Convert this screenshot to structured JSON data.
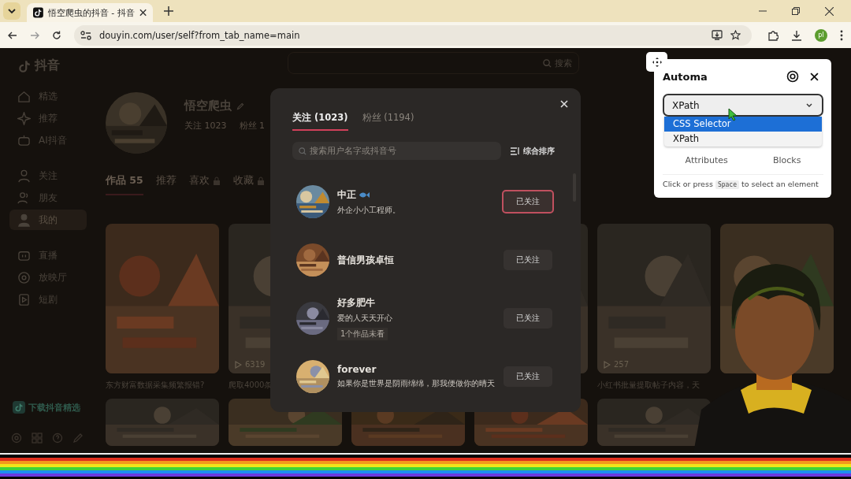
{
  "browser": {
    "tab": {
      "title": "悟空爬虫的抖音 - 抖音"
    },
    "url": "douyin.com/user/self?from_tab_name=main",
    "profile": "pl"
  },
  "page": {
    "logo": "抖音",
    "search_button": "搜索",
    "sidebar": [
      {
        "label": "精选",
        "selected": false
      },
      {
        "label": "推荐",
        "selected": false
      },
      {
        "label": "AI抖音",
        "selected": false
      },
      {
        "label": "关注",
        "selected": false
      },
      {
        "label": "朋友",
        "selected": false
      },
      {
        "label": "我的",
        "selected": true
      },
      {
        "label": "直播",
        "selected": false
      },
      {
        "label": "放映厅",
        "selected": false
      },
      {
        "label": "短剧",
        "selected": false
      }
    ],
    "download": "下载抖音精选",
    "profile": {
      "name": "悟空爬虫",
      "stats": [
        "关注 1023",
        "粉丝 1"
      ]
    },
    "profile_tabs": [
      {
        "label": "作品 55",
        "selected": true,
        "locked": false
      },
      {
        "label": "推荐",
        "selected": false,
        "locked": false
      },
      {
        "label": "喜欢",
        "selected": false,
        "locked": true
      },
      {
        "label": "收藏",
        "selected": false,
        "locked": true
      }
    ],
    "videos": [
      {
        "kind": "picture",
        "title": "东方财富数据采集频繁报错?"
      },
      {
        "kind": "picture",
        "plays": "6319",
        "title": "爬取4000条"
      },
      {
        "kind": "picture"
      },
      {
        "kind": "picture",
        "plays": "257",
        "title": "小红书批量提取帖子内容，天"
      },
      {
        "kind": "picture"
      }
    ]
  },
  "modal": {
    "tabs": [
      {
        "label": "关注 (1023)",
        "selected": true
      },
      {
        "label": "粉丝 (1194)",
        "selected": false
      }
    ],
    "search": {
      "placeholder": "搜索用户名字或抖音号"
    },
    "sort": "综合排序",
    "users": [
      {
        "name": "中正",
        "badge": true,
        "bio": "外企小小工程师。",
        "button": "已关注",
        "highlighted": true
      },
      {
        "name": "普信男孩卓恒",
        "badge": false,
        "button": "已关注",
        "highlighted": false
      },
      {
        "name": "好多肥牛",
        "badge": false,
        "bio": "爱的人天天开心",
        "note": "1个作品未看",
        "button": "已关注",
        "highlighted": false
      },
      {
        "name": "forever",
        "badge": false,
        "bio": "如果你是世界是阴雨绵绵，那我便做你的晴天",
        "button": "已关注",
        "highlighted": false
      }
    ]
  },
  "automa": {
    "title": "Automa",
    "select": {
      "value": "XPath",
      "options": [
        {
          "label": "CSS Selector",
          "highlighted": true
        },
        {
          "label": "XPath",
          "highlighted": false
        }
      ]
    },
    "tabs": [
      "Attributes",
      "Blocks"
    ],
    "hint": {
      "before": "Click or press",
      "key": "Space",
      "after": "to select an element"
    }
  }
}
